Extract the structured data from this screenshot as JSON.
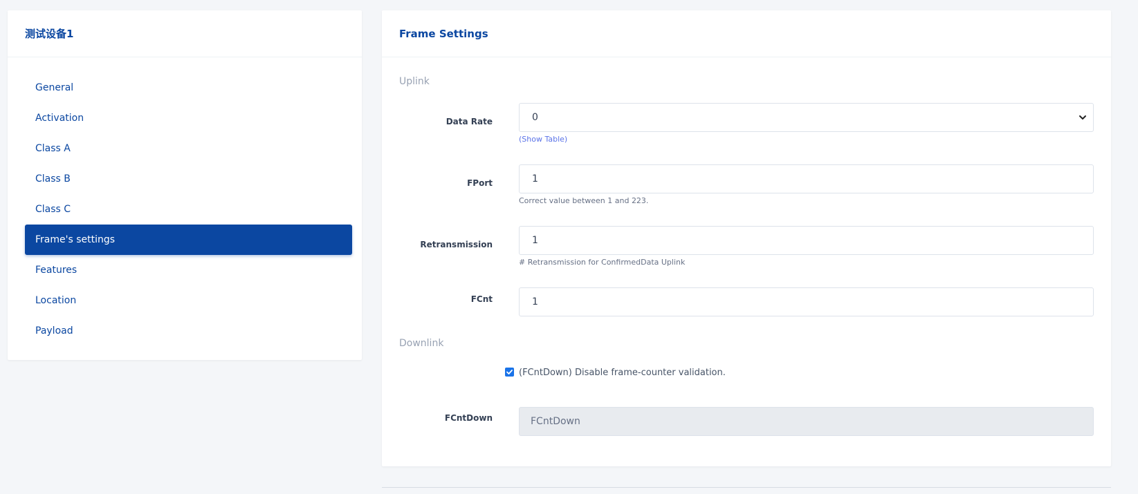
{
  "sidebar": {
    "title": "测试设备1",
    "items": [
      {
        "label": "General",
        "active": false
      },
      {
        "label": "Activation",
        "active": false
      },
      {
        "label": "Class A",
        "active": false
      },
      {
        "label": "Class B",
        "active": false
      },
      {
        "label": "Class C",
        "active": false
      },
      {
        "label": "Frame's settings",
        "active": true
      },
      {
        "label": "Features",
        "active": false
      },
      {
        "label": "Location",
        "active": false
      },
      {
        "label": "Payload",
        "active": false
      }
    ]
  },
  "main": {
    "title": "Frame Settings",
    "uplink": {
      "section_label": "Uplink",
      "data_rate": {
        "label": "Data Rate",
        "value": "0",
        "hint": "(Show Table)"
      },
      "fport": {
        "label": "FPort",
        "value": "1",
        "hint": "Correct value between 1 and 223."
      },
      "retransmission": {
        "label": "Retransmission",
        "value": "1",
        "hint": "# Retransmission for ConfirmedData Uplink"
      },
      "fcnt": {
        "label": "FCnt",
        "value": "1"
      }
    },
    "downlink": {
      "section_label": "Downlink",
      "disable_validation": {
        "label": "(FCntDown) Disable frame-counter validation.",
        "checked": true
      },
      "fcntdown": {
        "label": "FCntDown",
        "placeholder": "FCntDown"
      }
    }
  },
  "colors": {
    "brand": "#0b47a1",
    "background": "#f4f6f9",
    "checkbox": "#1a73e8"
  }
}
